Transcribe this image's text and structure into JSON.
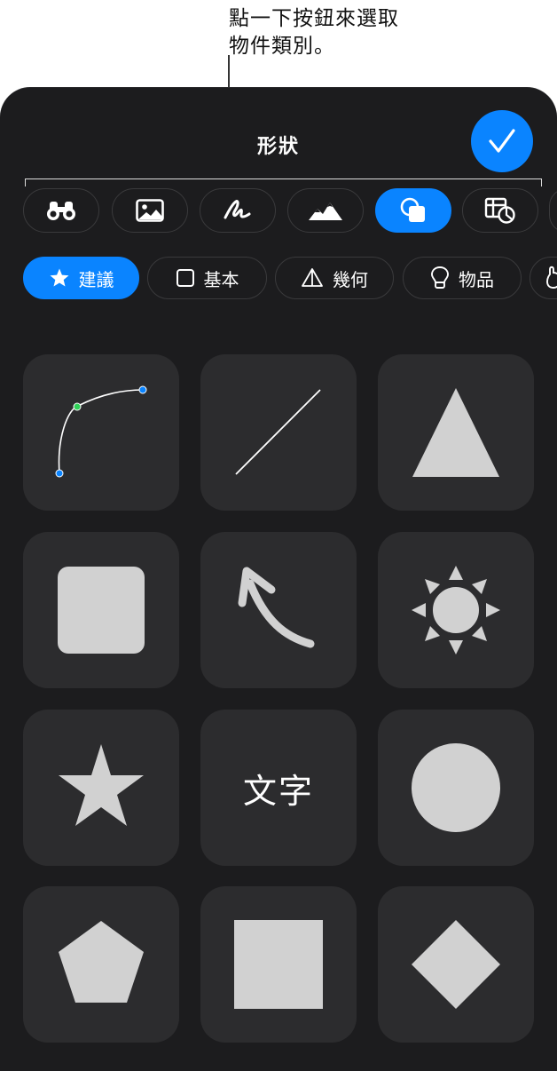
{
  "callout": {
    "line1": "點一下按鈕來選取",
    "line2": "物件類別。"
  },
  "header": {
    "title": "形狀"
  },
  "category_buttons": [
    {
      "icon": "binoculars-icon",
      "active": false
    },
    {
      "icon": "photo-icon",
      "active": false
    },
    {
      "icon": "scribble-icon",
      "active": false
    },
    {
      "icon": "mountains-icon",
      "active": false
    },
    {
      "icon": "shapes-icon",
      "active": true
    },
    {
      "icon": "table-chart-icon",
      "active": false
    }
  ],
  "chips": [
    {
      "label": "建議",
      "icon": "star-icon",
      "active": true
    },
    {
      "label": "基本",
      "icon": "square-icon",
      "active": false
    },
    {
      "label": "幾何",
      "icon": "pyramid-icon",
      "active": false
    },
    {
      "label": "物品",
      "icon": "lightbulb-icon",
      "active": false
    }
  ],
  "shapes": {
    "text_tile": "文字"
  },
  "colors": {
    "accent": "#0a84ff",
    "panel": "#1c1c1e",
    "tile": "#2c2c2e",
    "shape": "#d1d1d1"
  }
}
